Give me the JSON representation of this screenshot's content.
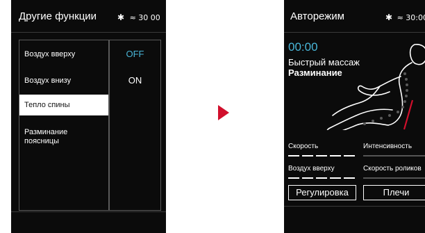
{
  "screen1": {
    "title": "Другие функции",
    "status": {
      "bluetooth_icon": "bluetooth-icon",
      "heat_icon": "heat-wave-icon",
      "time": "30 00"
    },
    "menu_items": [
      {
        "label": "Воздух вверху"
      },
      {
        "label": "Воздух внизу"
      },
      {
        "label": "Тепло спины",
        "selected": true
      },
      {
        "label": "Разминание поясницы"
      }
    ],
    "options": [
      {
        "label": "OFF",
        "color": "#49b6d8",
        "active": true
      },
      {
        "label": "ON",
        "color": "#ffffff",
        "active": false
      }
    ]
  },
  "transition_arrow_color": "#d10f2c",
  "screen2": {
    "title": "Авторежим",
    "status": {
      "bluetooth_icon": "bluetooth-icon",
      "heat_icon": "heat-wave-icon",
      "time": "30:00"
    },
    "timer": "00:00",
    "mode_label": "Быстрый массаж",
    "program": "Разминание",
    "sliders": [
      {
        "label": "Скорость",
        "level": 1.0
      },
      {
        "label": "Интенсивность",
        "level": 0.0
      },
      {
        "label": "Воздух вверху",
        "level": 1.0
      },
      {
        "label": "Скорость роликов",
        "level": 0.0
      }
    ],
    "buttons": [
      {
        "label": "Регулировка"
      },
      {
        "label": "Плечи"
      }
    ],
    "accent_color": "#d10f2c",
    "timer_color": "#49b6d8"
  }
}
